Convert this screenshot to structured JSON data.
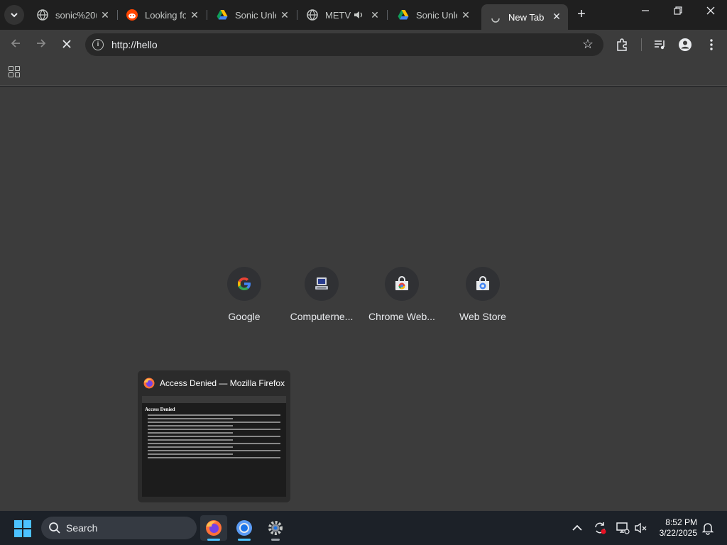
{
  "browser": {
    "tabs": [
      {
        "title": "sonic%20u",
        "icon": "globe-icon",
        "active": false
      },
      {
        "title": "Looking fo",
        "icon": "reddit-icon",
        "active": false
      },
      {
        "title": "Sonic Unle",
        "icon": "google-drive-icon",
        "active": false
      },
      {
        "title": "METV",
        "icon": "globe-icon",
        "active": false,
        "audio": true
      },
      {
        "title": "Sonic Unle",
        "icon": "google-drive-icon",
        "active": false
      },
      {
        "title": "New Tab",
        "icon": "loading-icon",
        "active": true
      }
    ],
    "address_bar": {
      "url": "http://hello"
    }
  },
  "new_tab": {
    "shortcuts": [
      {
        "label": "Google",
        "icon": "google-icon"
      },
      {
        "label": "Computerne...",
        "icon": "computer-icon"
      },
      {
        "label": "Chrome Web...",
        "icon": "chrome-web-store-icon"
      },
      {
        "label": "Web Store",
        "icon": "web-store-icon"
      }
    ]
  },
  "taskbar_preview": {
    "title": "Access Denied — Mozilla Firefox",
    "thumb_heading": "Access Denied"
  },
  "taskbar": {
    "search_label": "Search",
    "time": "8:52 PM",
    "date": "3/22/2025"
  },
  "colors": {
    "accent": "#4cc2ff",
    "chrome_bg": "#3c3c3c",
    "taskbar_bg": "#1c2128"
  }
}
